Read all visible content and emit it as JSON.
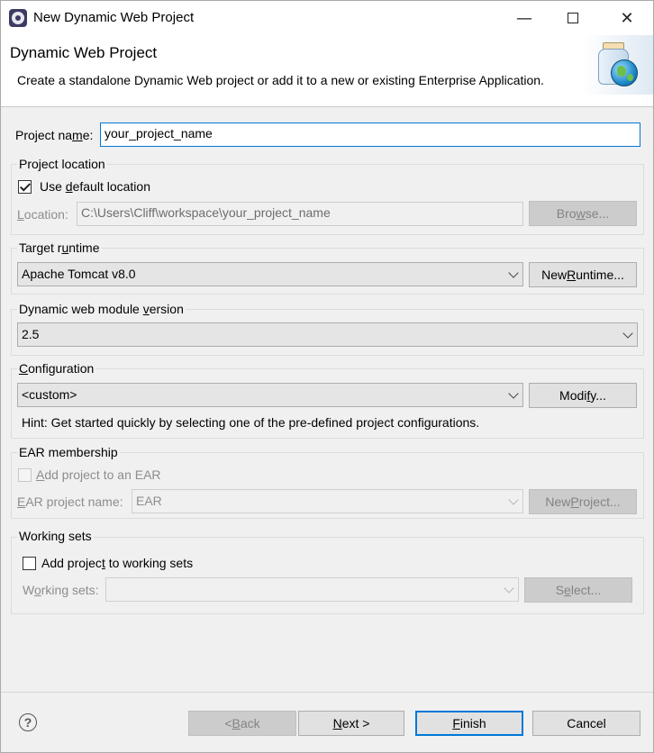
{
  "window": {
    "title": "New Dynamic Web Project",
    "minimize_icon": "minimize-icon",
    "maximize_icon": "maximize-icon",
    "close_icon": "close-icon"
  },
  "banner": {
    "title": "Dynamic Web Project",
    "description": "Create a standalone Dynamic Web project or add it to a new or existing Enterprise Application."
  },
  "project_name": {
    "label_pre": "Project na",
    "label_u": "m",
    "label_post": "e:",
    "value": "your_project_name"
  },
  "project_location": {
    "title": "Project location",
    "use_default_pre": "Use ",
    "use_default_u": "d",
    "use_default_post": "efault location",
    "use_default_checked": true,
    "location_label_u": "L",
    "location_label_post": "ocation:",
    "location_value": "C:\\Users\\Cliff\\workspace\\your_project_name",
    "browse_pre": "Bro",
    "browse_u": "w",
    "browse_post": "se..."
  },
  "target_runtime": {
    "title_pre": "Target r",
    "title_u": "u",
    "title_post": "ntime",
    "selected": "Apache Tomcat v8.0",
    "new_runtime_pre": "New ",
    "new_runtime_u": "R",
    "new_runtime_post": "untime..."
  },
  "module_version": {
    "title_pre": "Dynamic web module ",
    "title_u": "v",
    "title_post": "ersion",
    "selected": "2.5"
  },
  "configuration": {
    "title_u": "C",
    "title_post": "onfiguration",
    "selected": "<custom>",
    "modify_pre": "Modi",
    "modify_u": "f",
    "modify_post": "y...",
    "hint": "Hint: Get started quickly by selecting one of the pre-defined project configurations."
  },
  "ear_membership": {
    "title": "EAR membership",
    "add_to_ear_pre": "",
    "add_to_ear_u": "A",
    "add_to_ear_post": "dd project to an EAR",
    "ear_name_label_u": "E",
    "ear_name_label_post": "AR project name:",
    "ear_name_value": "EAR",
    "new_project_pre": "New ",
    "new_project_u": "P",
    "new_project_post": "roject..."
  },
  "working_sets": {
    "title": "Working sets",
    "add_pre": "Add projec",
    "add_u": "t",
    "add_post": " to working sets",
    "add_checked": false,
    "sets_label_pre": "W",
    "sets_label_u": "o",
    "sets_label_post": "rking sets:",
    "select_pre": "S",
    "select_u": "e",
    "select_post": "lect..."
  },
  "footer": {
    "help_icon": "help-icon",
    "help_glyph": "?",
    "back_pre": "< ",
    "back_u": "B",
    "back_post": "ack",
    "next_u": "N",
    "next_post": "ext >",
    "finish_u": "F",
    "finish_post": "inish",
    "cancel": "Cancel"
  },
  "colors": {
    "focus_border": "#0078d7",
    "dialog_bg": "#f0f0f0",
    "disabled_text": "#8d8d8d"
  }
}
